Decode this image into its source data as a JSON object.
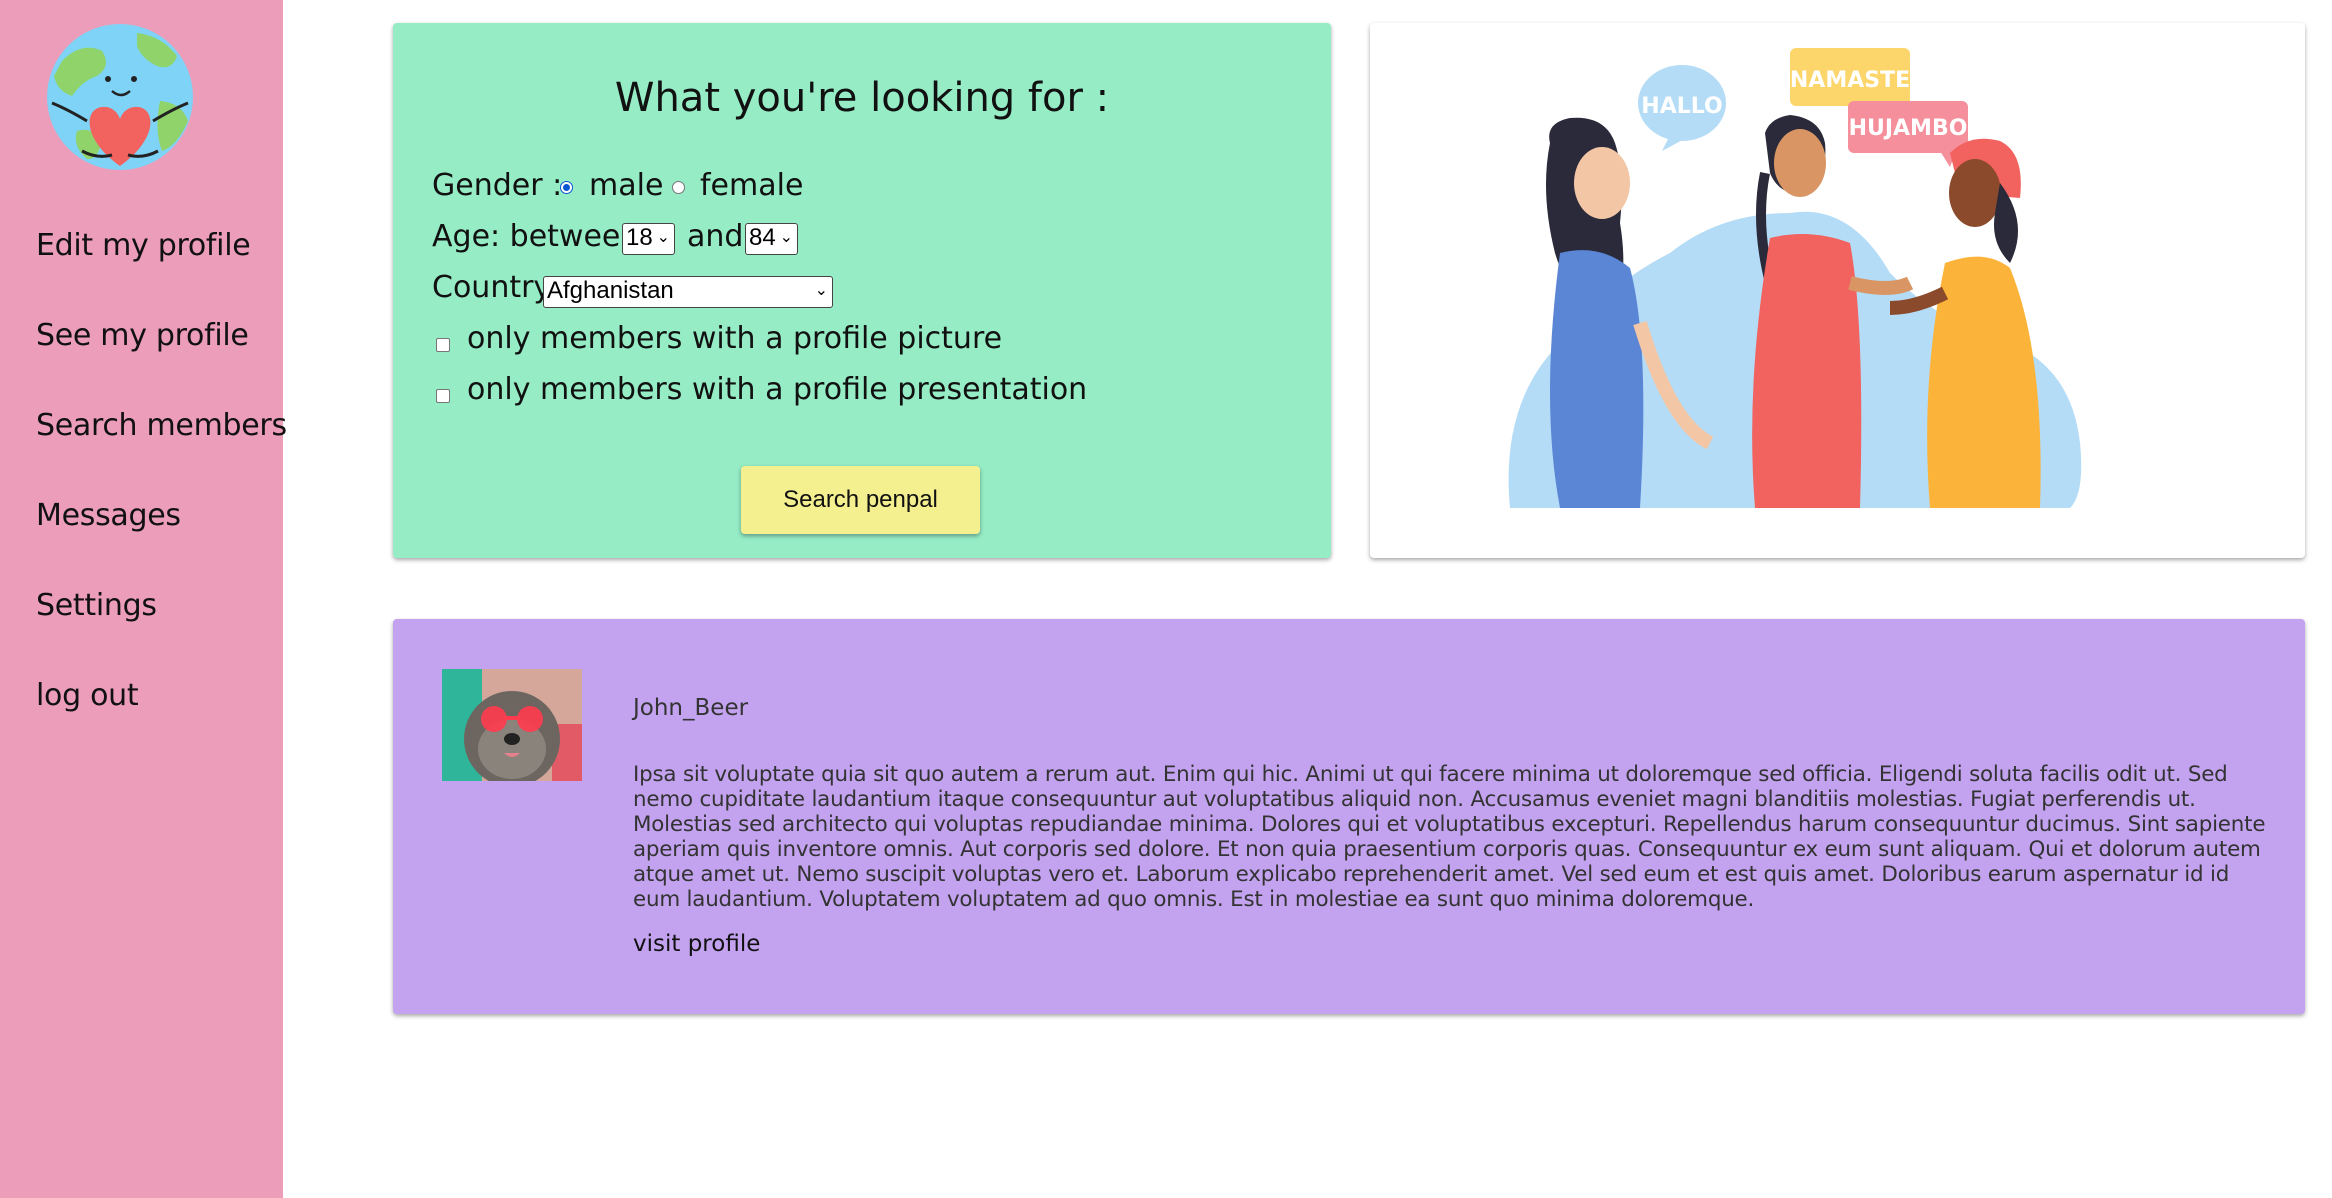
{
  "sidebar": {
    "items": [
      {
        "label": "Edit my profile"
      },
      {
        "label": "See my profile"
      },
      {
        "label": "Search members"
      },
      {
        "label": "Messages"
      },
      {
        "label": "Settings"
      },
      {
        "label": "log out"
      }
    ]
  },
  "search_form": {
    "title": "What you're looking for :",
    "gender_label": "Gender :",
    "gender_options": [
      "male",
      "female"
    ],
    "gender_selected": "male",
    "age_label": "Age: between",
    "age_and": "and",
    "age_min": "18",
    "age_max": "84",
    "country_label": "Country",
    "country_selected": "Afghanistan",
    "filter_picture": "only members with a profile picture",
    "filter_presentation": "only members with a profile presentation",
    "filter_picture_checked": false,
    "filter_presentation_checked": false,
    "submit_label": "Search penpal"
  },
  "illustration": {
    "bubbles": [
      "HALLO",
      "NAMASTE",
      "HUJAMBO"
    ]
  },
  "results": [
    {
      "username": "John_Beer",
      "bio": "Ipsa sit voluptate quia sit quo autem a rerum aut. Enim qui hic. Animi ut qui facere minima ut doloremque sed officia. Eligendi soluta facilis odit ut. Sed nemo cupiditate laudantium itaque consequuntur aut voluptatibus aliquid non. Accusamus eveniet magni blanditiis molestias. Fugiat perferendis ut. Molestias sed architecto qui voluptas repudiandae minima. Dolores qui et voluptatibus excepturi. Repellendus harum consequuntur ducimus. Sint sapiente aperiam quis inventore omnis. Aut corporis sed dolore. Et non quia praesentium corporis quas. Consequuntur ex eum sunt aliquam. Qui et dolorum autem atque amet ut. Nemo suscipit voluptas vero et. Laborum explicabo reprehenderit amet. Vel sed eum et est quis amet. Doloribus earum aspernatur id id eum laudantium. Voluptatem voluptatem ad quo omnis. Est in molestiae ea sunt quo minima doloremque.",
      "link_label": "visit profile"
    }
  ],
  "colors": {
    "sidebar": "#eb9dba",
    "search_card": "#95ecc5",
    "result_card": "#c3a3ef",
    "button": "#f5f08f"
  }
}
